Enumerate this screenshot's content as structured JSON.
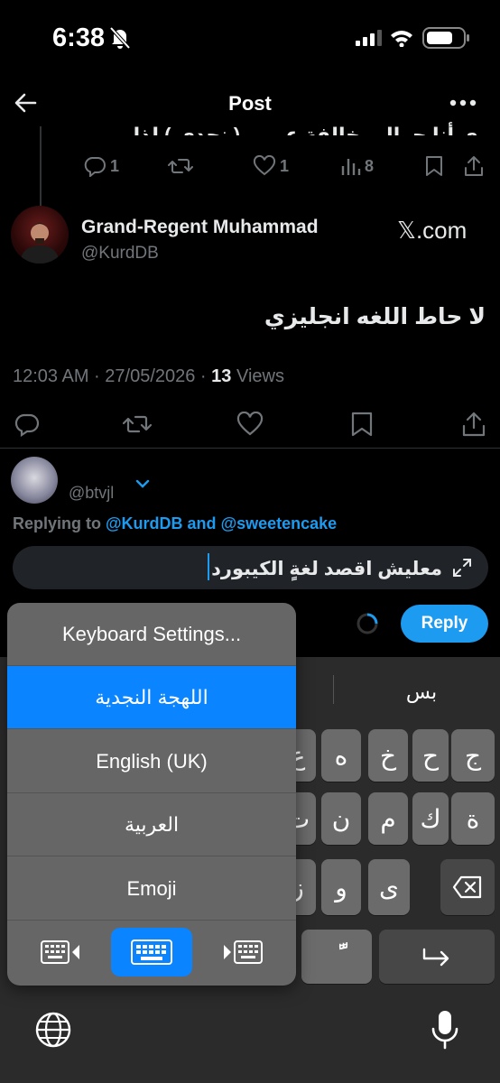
{
  "status_bar": {
    "time": "6:38"
  },
  "header": {
    "title": "Post"
  },
  "prev_tweet": {
    "text_fragment": "ري أنا جوالي خالفة عربي ( نجدي ) لذا",
    "replies": "1",
    "likes": "1",
    "views": "8"
  },
  "tweet": {
    "author_name": "Grand-Regent Muhammad",
    "author_handle": "@KurdDB",
    "badge": "𝕏.com",
    "body": "لا حاط اللغه انجليزي",
    "time": "12:03 AM · 27/05/2026 · ",
    "views_count": "13",
    "views_label": " Views"
  },
  "reply": {
    "handle": "@btvjl",
    "replying_prefix": "Replying to ",
    "mention_1": "@KurdDB",
    "and": " and ",
    "mention_2": "@sweetencake",
    "draft": "معليش اقصد لغةٍ الكيبورد",
    "button": "Reply"
  },
  "keyboard": {
    "suggestion": "بس",
    "row1": [
      "ج",
      "ح",
      "خ",
      "ه",
      "ع"
    ],
    "row2": [
      "ة",
      "ك",
      "م",
      "ن",
      "ت"
    ],
    "row3": [
      "ى",
      "و",
      "ز"
    ],
    "diacritic": "ًّ",
    "menu": {
      "settings": "Keyboard Settings...",
      "najdi": "اللهجة النجدية",
      "english": "English (UK)",
      "arabic": "العربية",
      "emoji": "Emoji"
    }
  },
  "colors": {
    "accent": "#1d9bf0",
    "menu_selected": "#0a84ff",
    "background": "#000000"
  }
}
